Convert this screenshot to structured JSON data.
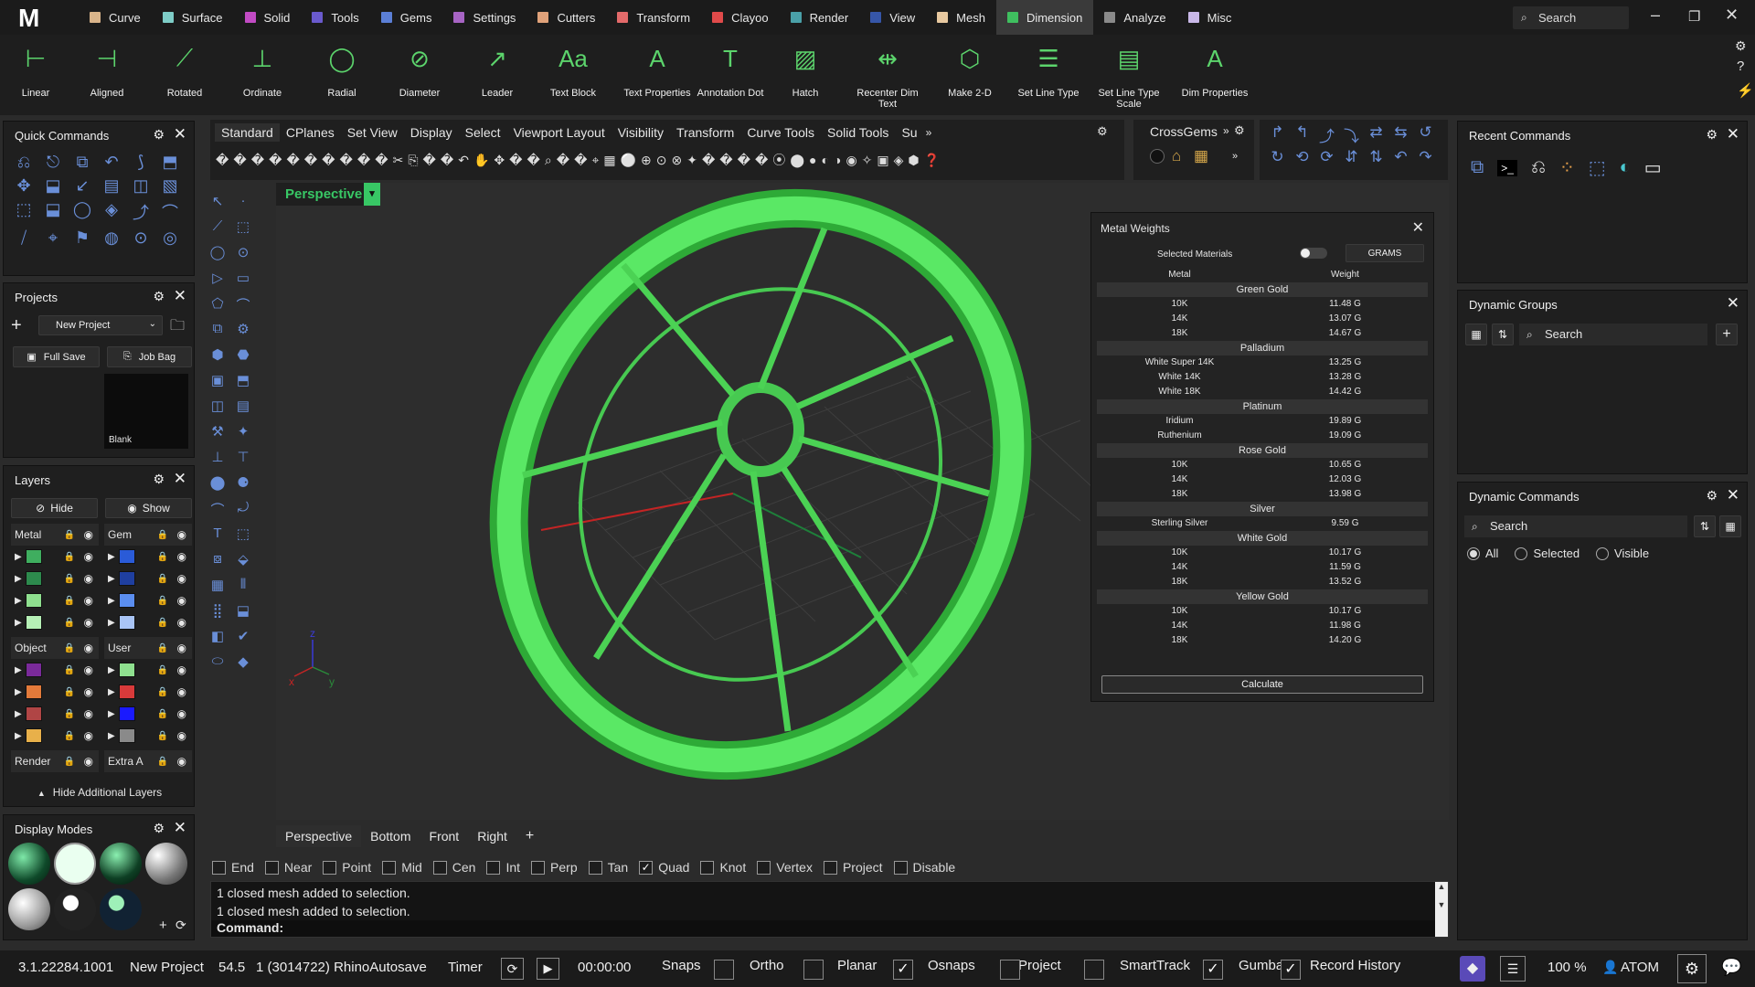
{
  "app": {
    "logo": "M"
  },
  "tabs": [
    {
      "label": "Curve",
      "color": "#d9b48a"
    },
    {
      "label": "Surface",
      "color": "#7ecdc7"
    },
    {
      "label": "Solid",
      "color": "#c24bc4"
    },
    {
      "label": "Tools",
      "color": "#6a5acd"
    },
    {
      "label": "Gems",
      "color": "#5b7fd6"
    },
    {
      "label": "Settings",
      "color": "#a764c4"
    },
    {
      "label": "Cutters",
      "color": "#e0a27a"
    },
    {
      "label": "Transform",
      "color": "#e36a6a"
    },
    {
      "label": "Clayoo",
      "color": "#e04a4a"
    },
    {
      "label": "Render",
      "color": "#4aa0a8"
    },
    {
      "label": "View",
      "color": "#3656a8"
    },
    {
      "label": "Mesh",
      "color": "#e8c9a0"
    },
    {
      "label": "Dimension",
      "color": "#3fbf5f",
      "active": true
    },
    {
      "label": "Analyze",
      "color": "#8a8a8a"
    },
    {
      "label": "Misc",
      "color": "#c9b8e8"
    }
  ],
  "top_search": "Search",
  "ribbon_tools": [
    "Linear",
    "Aligned",
    "Rotated",
    "Ordinate",
    "Radial",
    "Diameter",
    "Leader",
    "Text Block",
    "Text Properties",
    "Annotation Dot",
    "Hatch",
    "Recenter Dim Text",
    "Make 2-D",
    "Set Line Type",
    "Set Line Type Scale",
    "Dim Properties"
  ],
  "quick_commands": {
    "title": "Quick Commands"
  },
  "projects": {
    "title": "Projects",
    "selected": "New Project",
    "full_save": "Full Save",
    "job_bag": "Job Bag",
    "thumb_label": "Blank"
  },
  "layers": {
    "title": "Layers",
    "hide": "Hide",
    "show": "Show",
    "footer": "Hide Additional Layers",
    "groups": [
      {
        "name": "Metal",
        "colors": [
          "#3fae5f",
          "#2d8a4d",
          "#8fe08f",
          "#b6f0b6"
        ]
      },
      {
        "name": "Gem",
        "colors": [
          "#2a5bd8",
          "#1f3fa0",
          "#5b8ef0",
          "#a9c4f5"
        ]
      },
      {
        "name": "Object",
        "colors": [
          "#7a2a9a",
          "#e37a3a",
          "#b04545",
          "#e8b04a"
        ]
      },
      {
        "name": "User",
        "colors": [
          "#8fe08f",
          "#d83a3a",
          "#1a1aff",
          "#8a8a8a"
        ]
      },
      {
        "name": "Render",
        "colors": []
      },
      {
        "name": "Extra A",
        "colors": []
      }
    ]
  },
  "display_modes": {
    "title": "Display Modes"
  },
  "toolbar_tabs": [
    "Standard",
    "CPlanes",
    "Set View",
    "Display",
    "Select",
    "Viewport Layout",
    "Visibility",
    "Transform",
    "Curve Tools",
    "Solid Tools",
    "Su"
  ],
  "crossgems": "CrossGems",
  "viewport": {
    "active": "Perspective",
    "tabs": [
      "Perspective",
      "Bottom",
      "Front",
      "Right"
    ]
  },
  "metal_weights": {
    "title": "Metal Weights",
    "selected_materials": "Selected Materials",
    "unit": "GRAMS",
    "col_metal": "Metal",
    "col_weight": "Weight",
    "calculate": "Calculate",
    "groups": [
      {
        "name": "Green Gold",
        "items": [
          [
            "10K",
            "11.48 G"
          ],
          [
            "14K",
            "13.07 G"
          ],
          [
            "18K",
            "14.67 G"
          ]
        ]
      },
      {
        "name": "Palladium",
        "items": [
          [
            "White Super 14K",
            "13.25 G"
          ],
          [
            "White 14K",
            "13.28 G"
          ],
          [
            "White 18K",
            "14.42 G"
          ]
        ]
      },
      {
        "name": "Platinum",
        "items": [
          [
            "Iridium",
            "19.89 G"
          ],
          [
            "Ruthenium",
            "19.09 G"
          ]
        ]
      },
      {
        "name": "Rose Gold",
        "items": [
          [
            "10K",
            "10.65 G"
          ],
          [
            "14K",
            "12.03 G"
          ],
          [
            "18K",
            "13.98 G"
          ]
        ]
      },
      {
        "name": "Silver",
        "items": [
          [
            "Sterling Silver",
            "9.59 G"
          ]
        ]
      },
      {
        "name": "White Gold",
        "items": [
          [
            "10K",
            "10.17 G"
          ],
          [
            "14K",
            "11.59 G"
          ],
          [
            "18K",
            "13.52 G"
          ]
        ]
      },
      {
        "name": "Yellow Gold",
        "items": [
          [
            "10K",
            "10.17 G"
          ],
          [
            "14K",
            "11.98 G"
          ],
          [
            "18K",
            "14.20 G"
          ]
        ]
      }
    ]
  },
  "osnaps": [
    {
      "label": "End",
      "checked": false
    },
    {
      "label": "Near",
      "checked": false
    },
    {
      "label": "Point",
      "checked": false
    },
    {
      "label": "Mid",
      "checked": false
    },
    {
      "label": "Cen",
      "checked": false
    },
    {
      "label": "Int",
      "checked": false
    },
    {
      "label": "Perp",
      "checked": false
    },
    {
      "label": "Tan",
      "checked": false
    },
    {
      "label": "Quad",
      "checked": true
    },
    {
      "label": "Knot",
      "checked": false
    },
    {
      "label": "Vertex",
      "checked": false
    },
    {
      "label": "Project",
      "checked": false
    },
    {
      "label": "Disable",
      "checked": false
    }
  ],
  "command": {
    "history": [
      "1 closed mesh added to selection.",
      "1 closed mesh added to selection."
    ],
    "prompt": "Command:"
  },
  "recent_commands": {
    "title": "Recent Commands"
  },
  "dynamic_groups": {
    "title": "Dynamic Groups",
    "search": "Search"
  },
  "dynamic_commands": {
    "title": "Dynamic Commands",
    "search": "Search",
    "radios": [
      {
        "label": "All",
        "checked": true
      },
      {
        "label": "Selected",
        "checked": false
      },
      {
        "label": "Visible",
        "checked": false
      }
    ]
  },
  "status": {
    "version": "3.1.22284.1001",
    "project": "New Project",
    "num": "54.5",
    "autosave": "1 (3014722) RhinoAutosave",
    "timer": "Timer",
    "time": "00:00:00",
    "toggles": [
      {
        "label": "Snaps",
        "checked": false
      },
      {
        "label": "Ortho",
        "checked": false
      },
      {
        "label": "Planar",
        "checked": true
      },
      {
        "label": "Osnaps",
        "checked": false
      },
      {
        "label": "Project",
        "checked": false
      },
      {
        "label": "SmartTrack",
        "checked": true
      },
      {
        "label": "Gumball",
        "checked": true
      },
      {
        "label": "Record History",
        "checked": false
      }
    ],
    "zoom": "100 %",
    "user": "ATOM"
  }
}
